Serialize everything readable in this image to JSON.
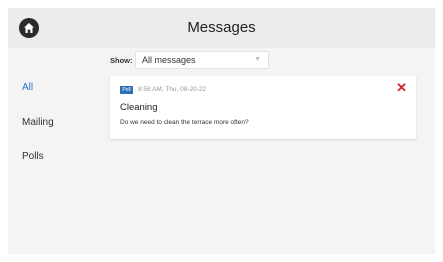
{
  "header": {
    "title": "Messages",
    "home_icon": "home-icon"
  },
  "sidebar": {
    "items": [
      {
        "label": "All"
      },
      {
        "label": "Mailing"
      },
      {
        "label": "Polls"
      }
    ]
  },
  "filter": {
    "label": "Show:",
    "selected": "All messages"
  },
  "messages": [
    {
      "badge": "Poll",
      "timestamp": "8:58 AM, Thu, 08-20-22",
      "title": "Cleaning",
      "body": "Do we need to clean the terrace more often?"
    }
  ],
  "colors": {
    "accent": "#2a73c9",
    "badge": "#2f6fb8",
    "delete": "#d2232a"
  }
}
